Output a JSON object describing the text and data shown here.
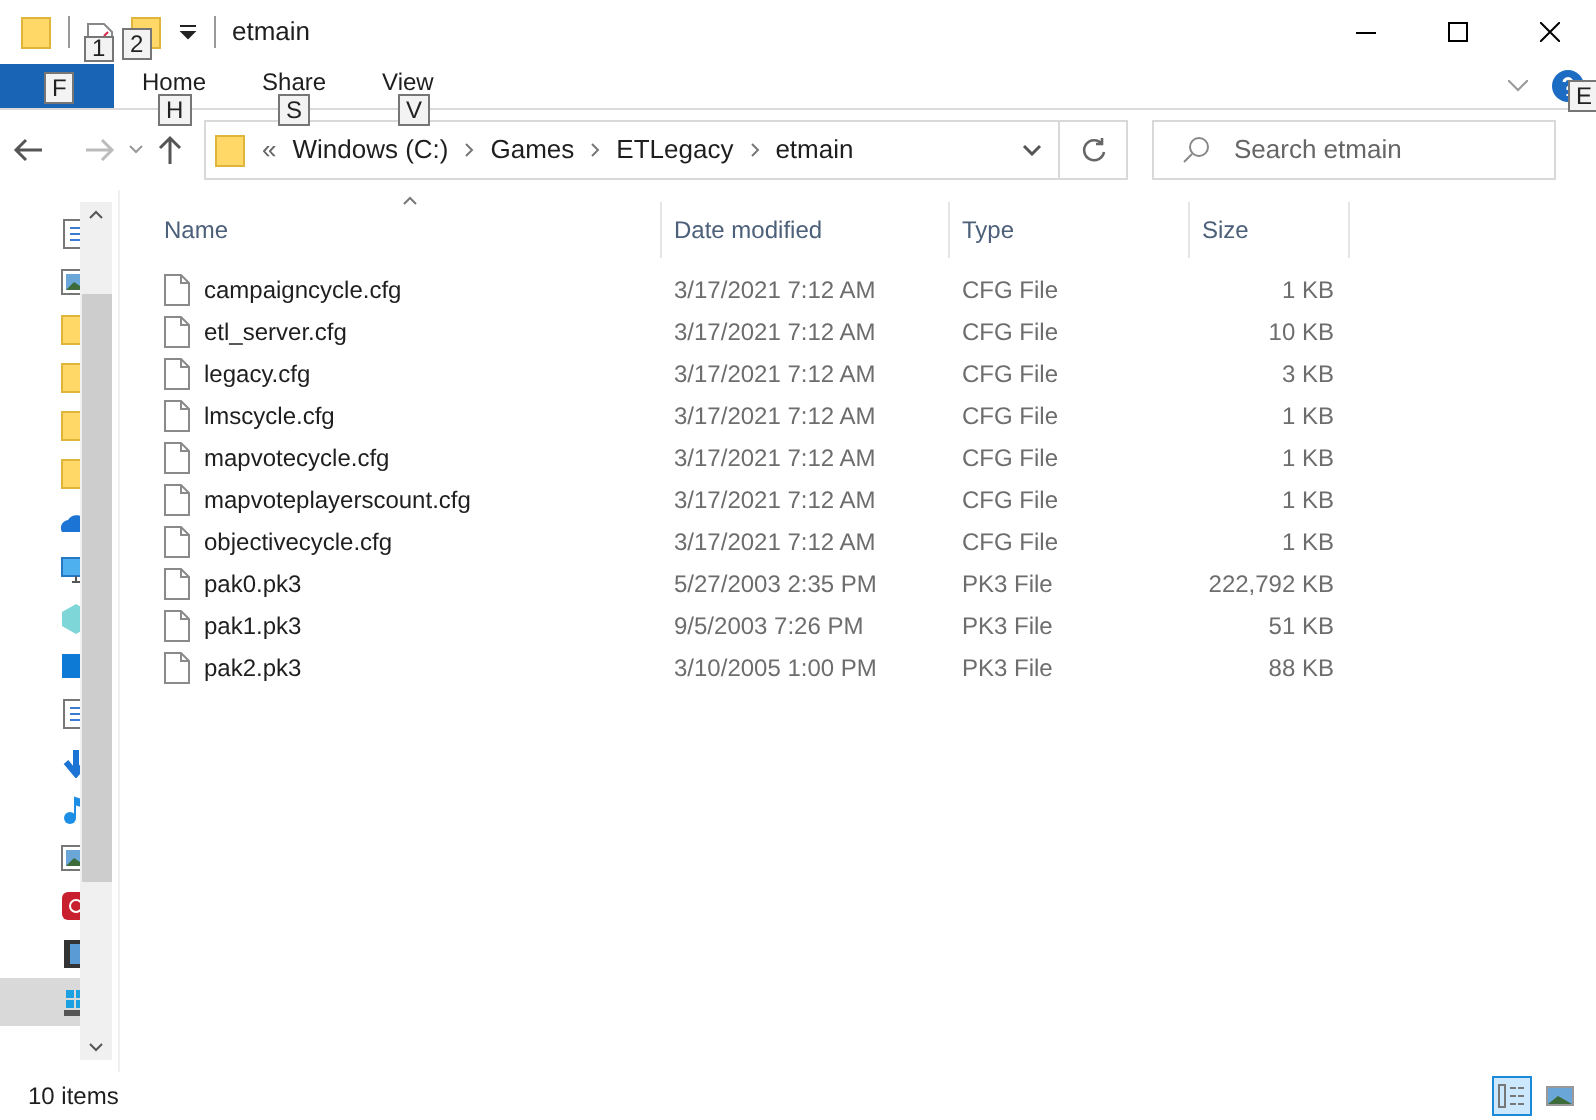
{
  "window": {
    "title": "etmain"
  },
  "quick_access_keytips": [
    "1",
    "2"
  ],
  "ribbon": {
    "tabs": [
      {
        "keytip": "F",
        "selected": true
      },
      {
        "label": "Home",
        "keytip": "H",
        "selected": false
      },
      {
        "label": "Share",
        "keytip": "S",
        "selected": false
      },
      {
        "label": "View",
        "keytip": "V",
        "selected": false
      }
    ],
    "help_keytip": "E"
  },
  "address_bar": {
    "overflow": "«",
    "path": [
      "Windows (C:)",
      "Games",
      "ETLegacy",
      "etmain"
    ]
  },
  "search": {
    "placeholder": "Search etmain"
  },
  "nav_pane": {
    "items": [
      {
        "kind": "document",
        "selected": false
      },
      {
        "kind": "image",
        "selected": false
      },
      {
        "kind": "folder",
        "selected": false
      },
      {
        "kind": "folder",
        "selected": false
      },
      {
        "kind": "folder",
        "selected": false
      },
      {
        "kind": "folder",
        "selected": false
      },
      {
        "kind": "cloud",
        "selected": false
      },
      {
        "kind": "computer",
        "selected": false
      },
      {
        "kind": "cube",
        "selected": false
      },
      {
        "kind": "desktop",
        "selected": false
      },
      {
        "kind": "document",
        "selected": false
      },
      {
        "kind": "download",
        "selected": false
      },
      {
        "kind": "music",
        "selected": false
      },
      {
        "kind": "image",
        "selected": false
      },
      {
        "kind": "app",
        "selected": false
      },
      {
        "kind": "video",
        "selected": false
      },
      {
        "kind": "drive",
        "selected": true
      }
    ]
  },
  "table": {
    "columns": [
      "Name",
      "Date modified",
      "Type",
      "Size"
    ],
    "rows": [
      {
        "name": "campaigncycle.cfg",
        "date": "3/17/2021 7:12 AM",
        "type": "CFG File",
        "size": "1 KB"
      },
      {
        "name": "etl_server.cfg",
        "date": "3/17/2021 7:12 AM",
        "type": "CFG File",
        "size": "10 KB"
      },
      {
        "name": "legacy.cfg",
        "date": "3/17/2021 7:12 AM",
        "type": "CFG File",
        "size": "3 KB"
      },
      {
        "name": "lmscycle.cfg",
        "date": "3/17/2021 7:12 AM",
        "type": "CFG File",
        "size": "1 KB"
      },
      {
        "name": "mapvotecycle.cfg",
        "date": "3/17/2021 7:12 AM",
        "type": "CFG File",
        "size": "1 KB"
      },
      {
        "name": "mapvoteplayerscount.cfg",
        "date": "3/17/2021 7:12 AM",
        "type": "CFG File",
        "size": "1 KB"
      },
      {
        "name": "objectivecycle.cfg",
        "date": "3/17/2021 7:12 AM",
        "type": "CFG File",
        "size": "1 KB"
      },
      {
        "name": "pak0.pk3",
        "date": "5/27/2003 2:35 PM",
        "type": "PK3 File",
        "size": "222,792 KB"
      },
      {
        "name": "pak1.pk3",
        "date": "9/5/2003 7:26 PM",
        "type": "PK3 File",
        "size": "51 KB"
      },
      {
        "name": "pak2.pk3",
        "date": "3/10/2005 1:00 PM",
        "type": "PK3 File",
        "size": "88 KB"
      }
    ]
  },
  "status_bar": {
    "count": "10 items",
    "view_buttons": [
      {
        "kind": "details",
        "selected": true
      },
      {
        "kind": "thumbnails",
        "selected": false
      }
    ]
  }
}
